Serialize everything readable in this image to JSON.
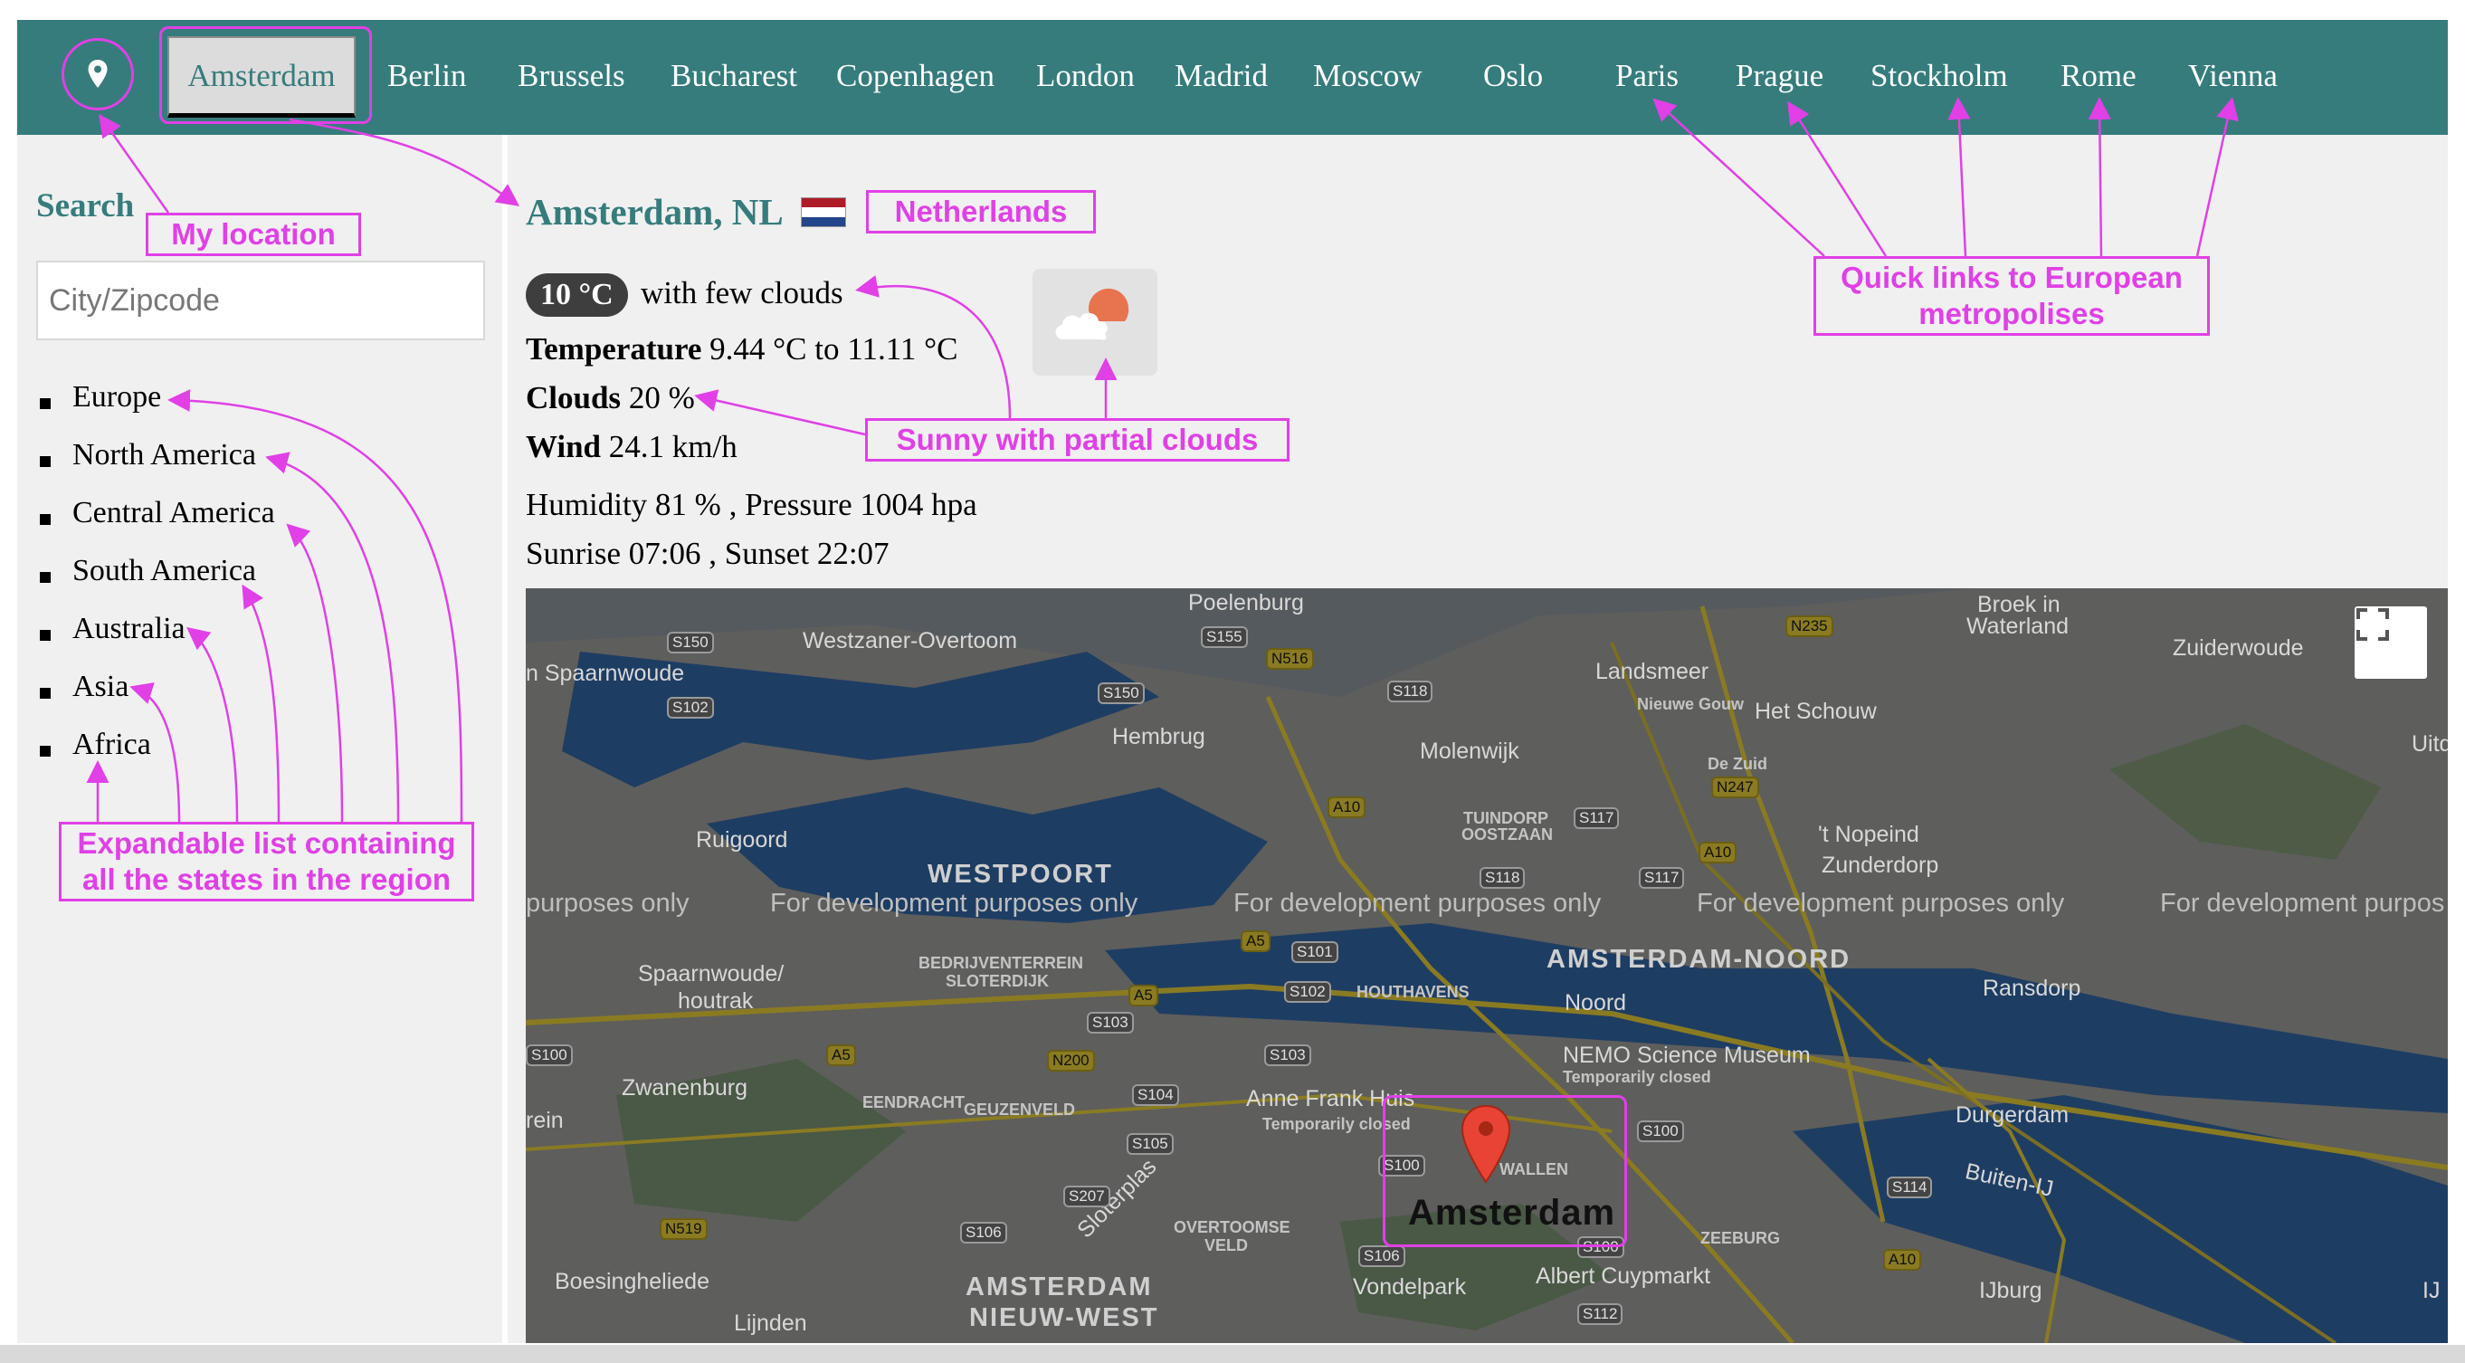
{
  "nav": {
    "location_icon": "map-pin-icon",
    "active_city": "Amsterdam",
    "cities": [
      "Berlin",
      "Brussels",
      "Bucharest",
      "Copenhagen",
      "London",
      "Madrid",
      "Moscow",
      "Oslo",
      "Paris",
      "Prague",
      "Stockholm",
      "Rome",
      "Vienna"
    ]
  },
  "sidebar": {
    "search_title": "Search",
    "search_placeholder": "City/Zipcode",
    "regions": [
      "Europe",
      "North America",
      "Central America",
      "South America",
      "Australia",
      "Asia",
      "Africa"
    ]
  },
  "weather": {
    "city": "Amsterdam, NL",
    "flag_colors": [
      "#ae1c28",
      "#ffffff",
      "#21468b"
    ],
    "temp_badge": "10 °C",
    "condition": "with few clouds",
    "temperature_label": "Temperature",
    "temperature_value": "9.44 °C to 11.11 °C",
    "clouds_label": "Clouds",
    "clouds_value": "20 %",
    "wind_label": "Wind",
    "wind_value": "24.1 km/h",
    "humidity_pressure": "Humidity 81 % , Pressure 1004 hpa",
    "sunrise_sunset": "Sunrise 07:06 , Sunset 22:07",
    "icon": "sun-cloud-icon"
  },
  "map": {
    "dev_notice": "For development purposes only",
    "dev_notice_partial_left": "purposes only",
    "dev_notice_partial_right": "For development purpos",
    "labels": {
      "poelenburg": "Poelenburg",
      "westzaner": "Westzaner-Overtoom",
      "spaarnwoude": "n Spaarnwoude",
      "hembrug": "Hembrug",
      "landsmeer": "Landsmeer",
      "nieuwe_gouw": "Nieuwe Gouw",
      "het_schouw": "Het Schouw",
      "broek1": "Broek in",
      "broek2": "Waterland",
      "zuiderwoude": "Zuiderwoude",
      "uitd": "Uitd",
      "molenwijk": "Molenwijk",
      "de_zuid": "De Zuid",
      "ruigoord": "Ruigoord",
      "tuindorp1": "TUINDORP",
      "tuindorp2": "OOSTZAAN",
      "nopeind1": "'t Nopeind",
      "nopeind2": "Zunderdorp",
      "westpoort": "WESTPOORT",
      "bedrijven1": "BEDRIJVENTERREIN",
      "bedrijven2": "SLOTERDIJK",
      "spaarnwoude_h1": "Spaarnwoude/",
      "spaarnwoude_h2": "houtrak",
      "ams_noord": "AMSTERDAM-NOORD",
      "houthavens": "HOUTHAVENS",
      "noord": "Noord",
      "ransdorp": "Ransdorp",
      "nemo": "NEMO Science Museum",
      "nemo_closed": "Temporarily closed",
      "zwanenburg": "Zwanenburg",
      "eendracht": "EENDRACHT",
      "geuzenveld": "GEUZENVELD",
      "anne_frank": "Anne Frank Huis",
      "anne_closed": "Temporarily closed",
      "wallen": "WALLEN",
      "rein": "rein",
      "durgerdam": "Durgerdam",
      "buiten_ij": "Buiten-IJ",
      "amsterdam": "Amsterdam",
      "overtoomse1": "OVERTOOMSE",
      "overtoomse2": "VELD",
      "sloterplas": "Sloterplas",
      "zeeburg": "ZEEBURG",
      "boesinghe": "Boesingheliede",
      "nieuw_west1": "AMSTERDAM",
      "nieuw_west2": "NIEUW-WEST",
      "vondelpark": "Vondelpark",
      "albert_cuyp": "Albert Cuypmarkt",
      "ijburg": "IJburg",
      "lijnden": "Lijnden",
      "ij": "IJ"
    },
    "shields": [
      "S150",
      "S155",
      "N516",
      "S102",
      "S150",
      "S118",
      "N235",
      "N247",
      "A10",
      "S117",
      "S118",
      "S117",
      "A10",
      "A5",
      "S101",
      "S102",
      "A5",
      "S103",
      "N200",
      "A5",
      "S103",
      "S104",
      "S105",
      "S207",
      "S100",
      "S100",
      "S106",
      "N519",
      "S100",
      "S114",
      "A10",
      "S106",
      "S112",
      "S100"
    ],
    "fullscreen_icon": "fullscreen-icon",
    "marker_icon": "map-marker-icon"
  },
  "annotations": {
    "my_location": "My location",
    "netherlands": "Netherlands",
    "quick_links_1": "Quick links to European",
    "quick_links_2": "metropolises",
    "sunny_clouds": "Sunny with partial clouds",
    "expandable_1": "Expandable list containing",
    "expandable_2": "all the states in the region"
  },
  "colors": {
    "accent": "#367c7c",
    "annotation": "#e040e6"
  }
}
